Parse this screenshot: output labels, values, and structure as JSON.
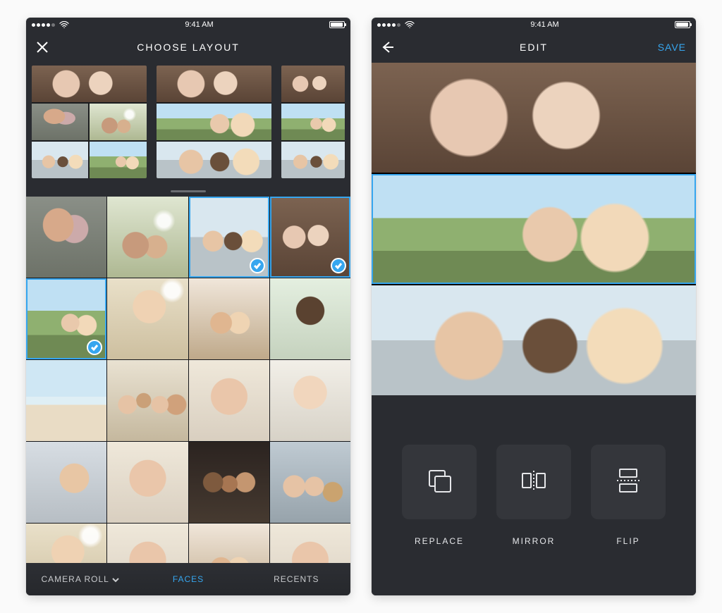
{
  "status": {
    "time": "9:41 AM"
  },
  "screen1": {
    "title": "CHOOSE LAYOUT",
    "tabs": {
      "camera_roll": "CAMERA ROLL",
      "faces": "FACES",
      "recents": "RECENTS",
      "active": "faces"
    },
    "layouts": [
      {
        "name": "grid-2x3"
      },
      {
        "name": "rows-3"
      },
      {
        "name": "rows-3-narrow"
      }
    ],
    "photos": [
      {
        "style": "p-girls",
        "selected": false
      },
      {
        "style": "p-sun",
        "selected": false
      },
      {
        "style": "p-teens",
        "selected": true
      },
      {
        "style": "p-upside",
        "selected": true
      },
      {
        "style": "p-selfie",
        "selected": true
      },
      {
        "style": "p-facesun",
        "selected": false
      },
      {
        "style": "p-pair",
        "selected": false
      },
      {
        "style": "p-woman",
        "selected": false
      },
      {
        "style": "p-beach",
        "selected": false
      },
      {
        "style": "p-group",
        "selected": false
      },
      {
        "style": "p-face",
        "selected": false
      },
      {
        "style": "p-glasses",
        "selected": false
      },
      {
        "style": "p-phone",
        "selected": false
      },
      {
        "style": "p-face",
        "selected": false
      },
      {
        "style": "p-dark",
        "selected": false
      },
      {
        "style": "p-dogs",
        "selected": false
      },
      {
        "style": "p-facesun",
        "selected": false
      },
      {
        "style": "p-face",
        "selected": false
      },
      {
        "style": "p-pair",
        "selected": false
      },
      {
        "style": "p-face",
        "selected": false
      }
    ]
  },
  "screen2": {
    "title": "EDIT",
    "save": "SAVE",
    "strips": [
      {
        "style": "p-upside",
        "selected": false
      },
      {
        "style": "p-selfie",
        "selected": true
      },
      {
        "style": "p-teens",
        "selected": false
      }
    ],
    "tools": {
      "replace": "REPLACE",
      "mirror": "MIRROR",
      "flip": "FLIP"
    }
  }
}
